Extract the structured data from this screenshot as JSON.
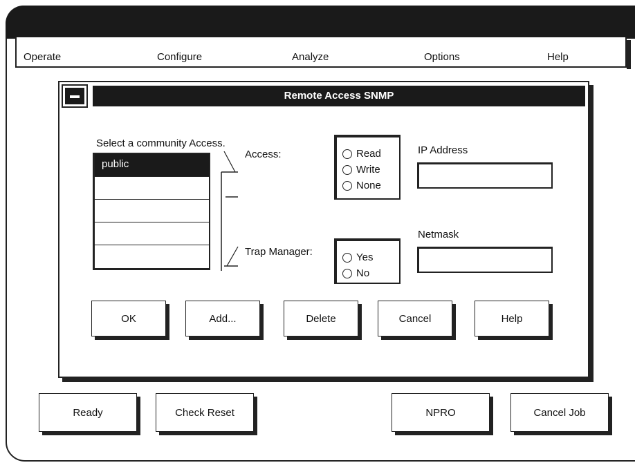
{
  "menu": [
    "Operate",
    "Configure",
    "Analyze",
    "Options",
    "Help"
  ],
  "dialog": {
    "title": "Remote Access SNMP",
    "community_label": "Select a community Access.",
    "communities": [
      "public",
      "",
      "",
      "",
      ""
    ],
    "selected_index": 0,
    "access_label": "Access:",
    "access_options": [
      "Read",
      "Write",
      "None"
    ],
    "trap_label": "Trap Manager:",
    "trap_options": [
      "Yes",
      "No"
    ],
    "ip_label": "IP Address",
    "ip_value": "",
    "netmask_label": "Netmask",
    "netmask_value": "",
    "buttons": [
      "OK",
      "Add...",
      "Delete",
      "Cancel",
      "Help"
    ]
  },
  "bottom_buttons": [
    "Ready",
    "Check Reset",
    "NPRO",
    "Cancel Job"
  ]
}
